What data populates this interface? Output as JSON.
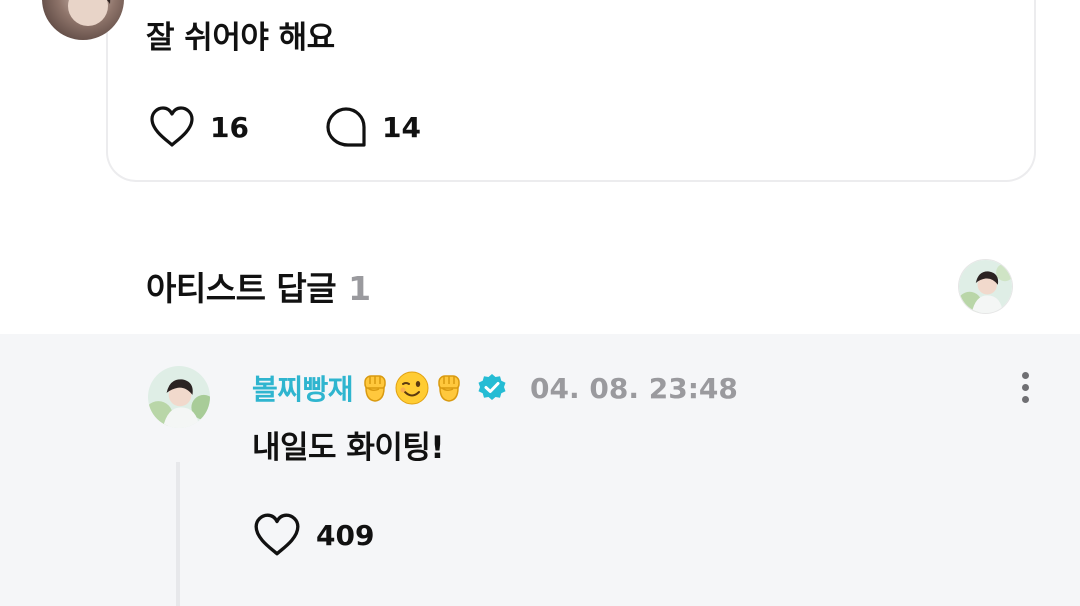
{
  "post": {
    "text": "잘 쉬어야 해요",
    "likes": "16",
    "comments": "14"
  },
  "artist_replies": {
    "title": "아티스트 답글",
    "count": "1"
  },
  "reply": {
    "author": "볼찌빵재",
    "author_emojis": [
      "raised-fist",
      "winking-face",
      "raised-fist"
    ],
    "timestamp": "04. 08. 23:48",
    "text": "내일도 화이팅!",
    "likes": "409"
  },
  "icons": {
    "like": "heart-outline-icon",
    "comment": "speech-bubble-icon",
    "verified": "verified-badge-icon",
    "more": "kebab-menu-icon"
  },
  "colors": {
    "accent": "#2fb5cf",
    "muted_text": "#9a9a9e",
    "reply_background": "#f5f6f8"
  }
}
